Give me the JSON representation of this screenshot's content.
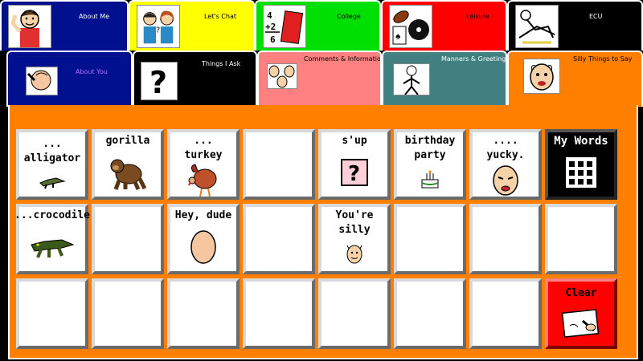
{
  "colors": {
    "board": "#ff7f00",
    "tab_about_me": "#00108f",
    "tab_lets_chat": "#ffff00",
    "tab_college": "#00e000",
    "tab_leisure": "#ff0000",
    "tab_ecu": "#000000",
    "tab_about_you": "#00108f",
    "tab_things_i_ask": "#000000",
    "tab_comments": "#ff8080",
    "tab_manners": "#408080",
    "tab_silly": "#ff7f00"
  },
  "tabs_row1": [
    {
      "label": "About Me",
      "icon": "boy-waving-icon"
    },
    {
      "label": "Let's Chat",
      "icon": "two-people-chatting-icon"
    },
    {
      "label": "College",
      "icon": "math-book-icon"
    },
    {
      "label": "Leisure",
      "icon": "games-music-icon"
    },
    {
      "label": "ECU",
      "icon": "person-relaxing-icon"
    }
  ],
  "tabs_row2": [
    {
      "label": "About You",
      "icon": "pointing-hand-icon"
    },
    {
      "label": "Things I Ask",
      "icon": "question-mark-icon"
    },
    {
      "label": "Comments & Information",
      "icon": "faces-icon"
    },
    {
      "label": "Manners & Greetings",
      "icon": "greeting-person-icon"
    },
    {
      "label": "Silly Things to Say",
      "icon": "silly-face-icon",
      "selected": true
    }
  ],
  "cells": [
    {
      "label": "... alligator",
      "icon": "alligator-icon"
    },
    {
      "label": "gorilla",
      "icon": "gorilla-icon"
    },
    {
      "label": "... turkey",
      "icon": "turkey-icon"
    },
    {
      "label": "",
      "icon": ""
    },
    {
      "label": "s'up",
      "icon": "question-box-icon"
    },
    {
      "label": "birthday party",
      "icon": "birthday-cake-icon"
    },
    {
      "label": ".... yucky.",
      "icon": "yucky-face-icon"
    },
    {
      "label": "My Words",
      "icon": "keyboard-icon",
      "style": "dark"
    },
    {
      "label": "...crocodile",
      "icon": "crocodile-icon"
    },
    {
      "label": "",
      "icon": ""
    },
    {
      "label": "Hey, dude",
      "icon": "head-icon"
    },
    {
      "label": "",
      "icon": ""
    },
    {
      "label": "You're silly",
      "icon": "small-face-icon"
    },
    {
      "label": "",
      "icon": ""
    },
    {
      "label": "",
      "icon": ""
    },
    {
      "label": "",
      "icon": ""
    },
    {
      "label": "",
      "icon": ""
    },
    {
      "label": "",
      "icon": ""
    },
    {
      "label": "",
      "icon": ""
    },
    {
      "label": "",
      "icon": ""
    },
    {
      "label": "",
      "icon": ""
    },
    {
      "label": "",
      "icon": ""
    },
    {
      "label": "",
      "icon": ""
    },
    {
      "label": "Clear",
      "icon": "eraser-hand-icon",
      "style": "red"
    }
  ]
}
